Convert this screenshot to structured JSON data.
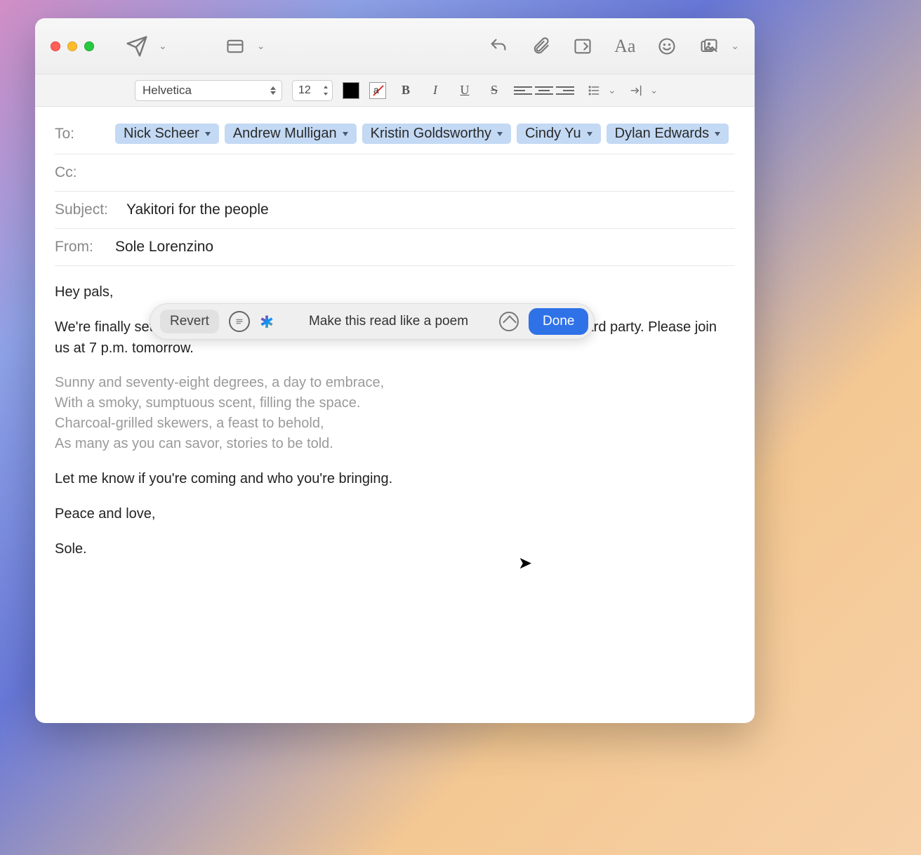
{
  "toolbar": {
    "font": "Helvetica",
    "size": "12"
  },
  "headers": {
    "to_label": "To:",
    "cc_label": "Cc:",
    "subject_label": "Subject:",
    "from_label": "From:",
    "recipients": [
      "Nick Scheer",
      "Andrew Mulligan",
      "Kristin Goldsworthy",
      "Cindy Yu",
      "Dylan Edwards"
    ],
    "subject": "Yakitori for the people",
    "from": "Sole Lorenzino"
  },
  "body": {
    "p1": "Hey pals,",
    "p2": "We're finally settled into the new place which means we're ready for our annual backyard party. Please join us at 7 p.m. tomorrow.",
    "poem": [
      "Sunny and seventy-eight degrees, a day to embrace,",
      "With a smoky, sumptuous scent, filling the space.",
      "Charcoal-grilled skewers, a feast to behold,",
      "As many as you can savor, stories to be told."
    ],
    "p3": "Let me know if you're coming and who you're bringing.",
    "p4": "Peace and love,",
    "p5": "Sole."
  },
  "ai": {
    "revert": "Revert",
    "prompt": "Make this read like a poem",
    "done": "Done"
  }
}
